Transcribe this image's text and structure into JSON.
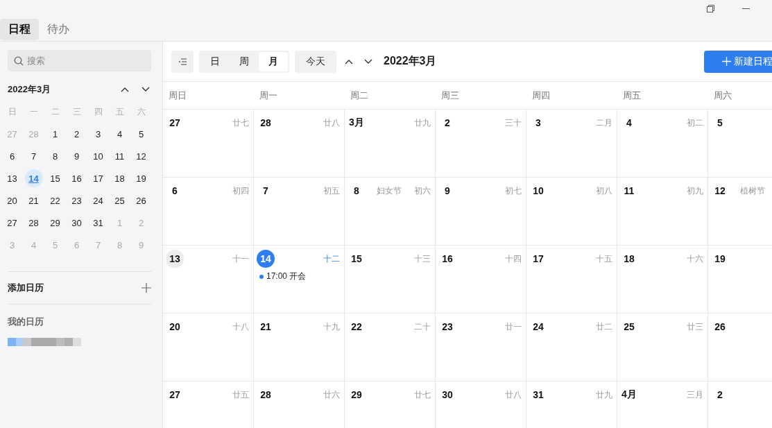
{
  "tabs": [
    {
      "label": "日程",
      "selected": true
    },
    {
      "label": "待办",
      "selected": false
    }
  ],
  "sidebar": {
    "search": {
      "placeholder": "搜索"
    },
    "mini_calendar": {
      "title": "2022年3月",
      "weekdays": [
        "日",
        "一",
        "二",
        "三",
        "四",
        "五",
        "六"
      ],
      "days": [
        {
          "label": "27",
          "kind": "other"
        },
        {
          "label": "28",
          "kind": "other"
        },
        {
          "label": "1",
          "kind": "day"
        },
        {
          "label": "2",
          "kind": "day"
        },
        {
          "label": "3",
          "kind": "day"
        },
        {
          "label": "4",
          "kind": "day"
        },
        {
          "label": "5",
          "kind": "day"
        },
        {
          "label": "6",
          "kind": "day"
        },
        {
          "label": "7",
          "kind": "day"
        },
        {
          "label": "8",
          "kind": "day"
        },
        {
          "label": "9",
          "kind": "day"
        },
        {
          "label": "10",
          "kind": "day"
        },
        {
          "label": "11",
          "kind": "day"
        },
        {
          "label": "12",
          "kind": "day"
        },
        {
          "label": "13",
          "kind": "day"
        },
        {
          "label": "14",
          "kind": "today"
        },
        {
          "label": "15",
          "kind": "day"
        },
        {
          "label": "16",
          "kind": "day"
        },
        {
          "label": "17",
          "kind": "day"
        },
        {
          "label": "18",
          "kind": "day"
        },
        {
          "label": "19",
          "kind": "day"
        },
        {
          "label": "20",
          "kind": "day"
        },
        {
          "label": "21",
          "kind": "day"
        },
        {
          "label": "22",
          "kind": "day"
        },
        {
          "label": "23",
          "kind": "day"
        },
        {
          "label": "24",
          "kind": "day"
        },
        {
          "label": "25",
          "kind": "day"
        },
        {
          "label": "26",
          "kind": "day"
        },
        {
          "label": "27",
          "kind": "day"
        },
        {
          "label": "28",
          "kind": "day"
        },
        {
          "label": "29",
          "kind": "day"
        },
        {
          "label": "30",
          "kind": "day"
        },
        {
          "label": "31",
          "kind": "day"
        },
        {
          "label": "1",
          "kind": "other"
        },
        {
          "label": "2",
          "kind": "other"
        },
        {
          "label": "3",
          "kind": "other"
        },
        {
          "label": "4",
          "kind": "other"
        },
        {
          "label": "5",
          "kind": "other"
        },
        {
          "label": "6",
          "kind": "other"
        },
        {
          "label": "7",
          "kind": "other"
        },
        {
          "label": "8",
          "kind": "other"
        },
        {
          "label": "9",
          "kind": "other"
        }
      ]
    },
    "add_calendar": "添加日历",
    "my_calendars": "我的日历"
  },
  "toolbar": {
    "views": [
      {
        "label": "日",
        "selected": false
      },
      {
        "label": "周",
        "selected": false
      },
      {
        "label": "月",
        "selected": true
      }
    ],
    "today": "今天",
    "title": "2022年3月",
    "new_button": "新建日程"
  },
  "month": {
    "weekdays": [
      "周日",
      "周一",
      "周二",
      "周三",
      "周四",
      "周五",
      "周六"
    ],
    "cells": [
      {
        "day": "27",
        "lunar": "廿七",
        "kind": "day"
      },
      {
        "day": "28",
        "lunar": "廿八",
        "kind": "day"
      },
      {
        "day": "3月",
        "lunar": "廿九",
        "kind": "day"
      },
      {
        "day": "2",
        "lunar": "三十",
        "kind": "day"
      },
      {
        "day": "3",
        "lunar": "二月",
        "kind": "day"
      },
      {
        "day": "4",
        "lunar": "初二",
        "kind": "day"
      },
      {
        "day": "5",
        "kind": "day"
      },
      {
        "day": "6",
        "lunar": "初四",
        "kind": "day"
      },
      {
        "day": "7",
        "lunar": "初五",
        "kind": "day"
      },
      {
        "day": "8",
        "festival": "妇女节",
        "lunar": "初六",
        "kind": "day"
      },
      {
        "day": "9",
        "lunar": "初七",
        "kind": "day"
      },
      {
        "day": "10",
        "lunar": "初八",
        "kind": "day"
      },
      {
        "day": "11",
        "lunar": "初九",
        "kind": "day"
      },
      {
        "day": "12",
        "festival": "植树节",
        "kind": "day"
      },
      {
        "day": "13",
        "lunar": "十一",
        "kind": "hover"
      },
      {
        "day": "14",
        "lunar": "十二",
        "kind": "today",
        "events": [
          {
            "text": "17:00 开会",
            "color": "#2f7ef0"
          }
        ]
      },
      {
        "day": "15",
        "lunar": "十三",
        "kind": "day"
      },
      {
        "day": "16",
        "lunar": "十四",
        "kind": "day"
      },
      {
        "day": "17",
        "lunar": "十五",
        "kind": "day"
      },
      {
        "day": "18",
        "lunar": "十六",
        "kind": "day"
      },
      {
        "day": "19",
        "kind": "day"
      },
      {
        "day": "20",
        "lunar": "十八",
        "kind": "day"
      },
      {
        "day": "21",
        "lunar": "十九",
        "kind": "day"
      },
      {
        "day": "22",
        "lunar": "二十",
        "kind": "day"
      },
      {
        "day": "23",
        "lunar": "廿一",
        "kind": "day"
      },
      {
        "day": "24",
        "lunar": "廿二",
        "kind": "day"
      },
      {
        "day": "25",
        "lunar": "廿三",
        "kind": "day"
      },
      {
        "day": "26",
        "kind": "day"
      },
      {
        "day": "27",
        "lunar": "廿五",
        "kind": "day"
      },
      {
        "day": "28",
        "lunar": "廿六",
        "kind": "day"
      },
      {
        "day": "29",
        "lunar": "廿七",
        "kind": "day"
      },
      {
        "day": "30",
        "lunar": "廿八",
        "kind": "day"
      },
      {
        "day": "31",
        "lunar": "廿九",
        "kind": "day"
      },
      {
        "day": "4月",
        "lunar": "三月",
        "kind": "day"
      },
      {
        "day": "2",
        "kind": "day"
      }
    ]
  }
}
